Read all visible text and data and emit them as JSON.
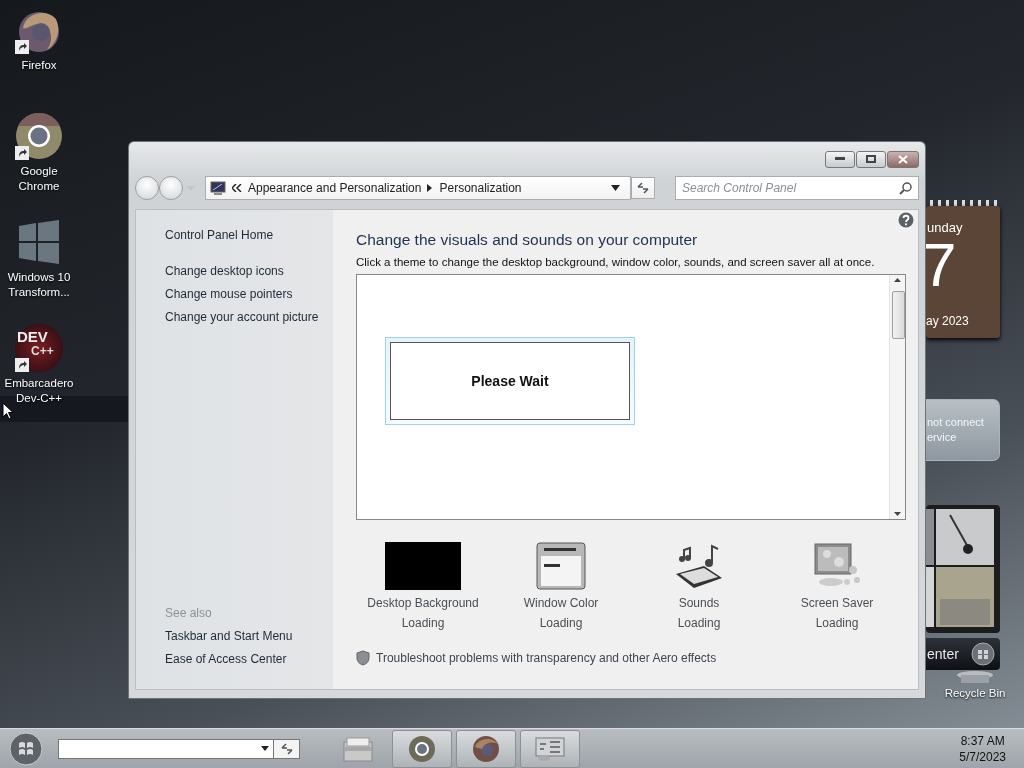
{
  "desktop_icons": [
    {
      "label": "Firefox",
      "kind": "firefox",
      "selected": false
    },
    {
      "label": "Google Chrome",
      "kind": "chrome",
      "selected": false
    },
    {
      "label": "Windows 10 Transform...",
      "kind": "windows",
      "selected": false
    },
    {
      "label": "Embarcadero Dev-C++",
      "kind": "devcpp",
      "logo_text": "DEV",
      "logo_sub": "C++",
      "selected": true
    }
  ],
  "gadgets": {
    "calendar": {
      "weekday": "unday",
      "day": "7",
      "month": "ay 2023"
    },
    "weather": {
      "lines": [
        "not connect",
        "ervice"
      ]
    },
    "media_center": {
      "label": "enter"
    }
  },
  "recycle_bin": {
    "label": "Recycle Bin"
  },
  "window": {
    "breadcrumb": [
      "Appearance and Personalization",
      "Personalization"
    ],
    "search": {
      "placeholder": "Search Control Panel"
    },
    "sidebar": {
      "items": [
        "Control Panel Home",
        "Change desktop icons",
        "Change mouse pointers",
        "Change your account picture"
      ],
      "see_also_title": "See also",
      "see_also": [
        "Taskbar and Start Menu",
        "Ease of Access Center"
      ]
    },
    "heading": "Change the visuals and sounds on your computer",
    "subtitle": "Click a theme to change the desktop background, window color, sounds, and screen saver all at once.",
    "wait_dialog": "Please Wait",
    "settings": [
      {
        "kind": "background",
        "label": "Desktop Background",
        "status": "Loading"
      },
      {
        "kind": "color",
        "label": "Window Color",
        "status": "Loading"
      },
      {
        "kind": "sounds",
        "label": "Sounds",
        "status": "Loading"
      },
      {
        "kind": "screensaver",
        "label": "Screen Saver",
        "status": "Loading"
      }
    ],
    "troubleshoot": "Troubleshoot problems with transparency and other Aero effects"
  },
  "taskbar": {
    "buttons": [
      {
        "kind": "explorer",
        "running": false
      },
      {
        "kind": "chrome",
        "running": true
      },
      {
        "kind": "firefox",
        "running": true
      },
      {
        "kind": "control_panel",
        "running": true
      }
    ],
    "time": "8:37 AM",
    "date": "5/7/2023"
  }
}
